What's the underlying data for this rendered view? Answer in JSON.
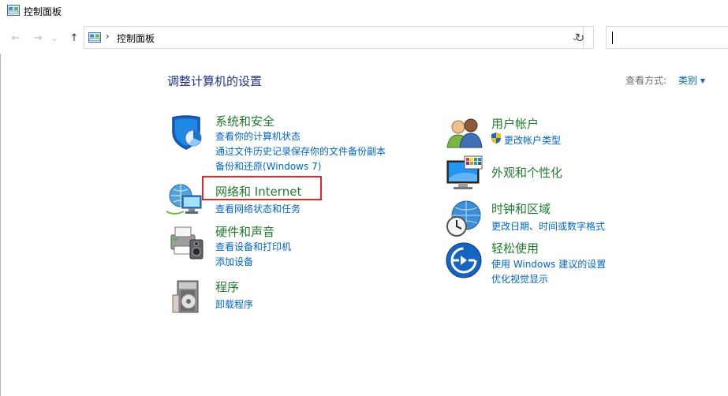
{
  "window": {
    "title": "控制面板"
  },
  "nav": {
    "back": "←",
    "forward": "→",
    "recent": "⌄",
    "up": "↑"
  },
  "address": {
    "separator": "›",
    "path": "控制面板",
    "dropdown": "⌄",
    "refresh": "↻"
  },
  "search": {
    "value": ""
  },
  "main": {
    "heading": "调整计算机的设置",
    "view_by_label": "查看方式:",
    "view_by_value": "类别 ▾"
  },
  "categories": {
    "system_security": {
      "title": "系统和安全",
      "links": [
        "查看你的计算机状态",
        "通过文件历史记录保存你的文件备份副本",
        "备份和还原(Windows 7)"
      ],
      "icon": "shield-icon"
    },
    "network": {
      "title": "网络和 Internet",
      "links": [
        "查看网络状态和任务"
      ],
      "icon": "network-globe-icon",
      "highlighted": true
    },
    "hardware": {
      "title": "硬件和声音",
      "links": [
        "查看设备和打印机",
        "添加设备"
      ],
      "icon": "printer-speaker-icon"
    },
    "programs": {
      "title": "程序",
      "links": [
        "卸载程序"
      ],
      "icon": "programs-disc-icon"
    },
    "user_accounts": {
      "title": "用户帐户",
      "links": [
        "更改帐户类型"
      ],
      "icon": "users-icon"
    },
    "appearance": {
      "title": "外观和个性化",
      "links": [],
      "icon": "monitor-palette-icon"
    },
    "clock_region": {
      "title": "时钟和区域",
      "links": [
        "更改日期、时间或数字格式"
      ],
      "icon": "clock-globe-icon"
    },
    "ease_of_access": {
      "title": "轻松使用",
      "links": [
        "使用 Windows 建议的设置",
        "优化视觉显示"
      ],
      "icon": "ease-of-access-icon"
    }
  },
  "colors": {
    "category_title": "#227a2f",
    "link": "#0066cc",
    "heading": "#1e3287",
    "highlight_border": "#e0262b"
  }
}
